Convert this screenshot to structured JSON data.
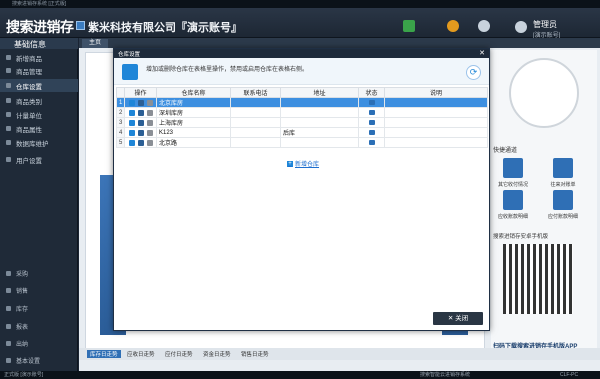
{
  "window": {
    "title": "搜索进销存系统 [正式版]",
    "controls": [
      "–",
      "□",
      "✕"
    ]
  },
  "header": {
    "brand": "搜索进销存",
    "company": "紫米科技有限公司『演示账号』",
    "user": {
      "name": "管理员",
      "role": "[演示账号]"
    }
  },
  "sidebar": {
    "head": "基础信息",
    "items": [
      {
        "label": "新增商品"
      },
      {
        "label": "商品管理"
      },
      {
        "label": "仓库设置"
      },
      {
        "label": "商品类别"
      },
      {
        "label": "计量单位"
      },
      {
        "label": "商品属性"
      },
      {
        "label": "数据库维护"
      },
      {
        "label": "用户设置"
      }
    ],
    "bottom": [
      "采购",
      "销售",
      "库存",
      "报表",
      "出纳",
      "基本设置"
    ]
  },
  "main": {
    "home_tab": "主页",
    "bottom_tabs": [
      "库存日走势",
      "应收日走势",
      "应付日走势",
      "资金日走势",
      "销售日走势"
    ],
    "quick_head": "快捷通道",
    "quick_items": [
      "其它收付情况",
      "往来对账单",
      "应收账款明细",
      "应付账款明细"
    ],
    "qr_head": "搜索进销存安卓手机版",
    "qr_caption": "扫码下载搜索进销存手机版APP"
  },
  "dialog": {
    "title": "仓库设置",
    "close_glyph": "✕",
    "info": "增加或删除仓库在表格里操作，禁用或启用仓库在表格右侧。",
    "columns": [
      "操作",
      "仓库名称",
      "联系电话",
      "地址",
      "状态",
      "说明"
    ],
    "rows": [
      {
        "num": "1",
        "name": "北京库房",
        "phone": "",
        "address": "",
        "note": ""
      },
      {
        "num": "2",
        "name": "深圳库房",
        "phone": "",
        "address": "",
        "note": ""
      },
      {
        "num": "3",
        "name": "上海库房",
        "phone": "",
        "address": "",
        "note": ""
      },
      {
        "num": "4",
        "name": "K123",
        "phone": "",
        "address": "后库",
        "note": ""
      },
      {
        "num": "5",
        "name": "北京路",
        "phone": "",
        "address": "",
        "note": ""
      }
    ],
    "add_link": "新增仓库",
    "close_button": "关闭"
  },
  "statusbar": {
    "left": "正式版 [演示账号]",
    "right": "搜索智能云进销存系统",
    "version": "CLF-PC"
  }
}
